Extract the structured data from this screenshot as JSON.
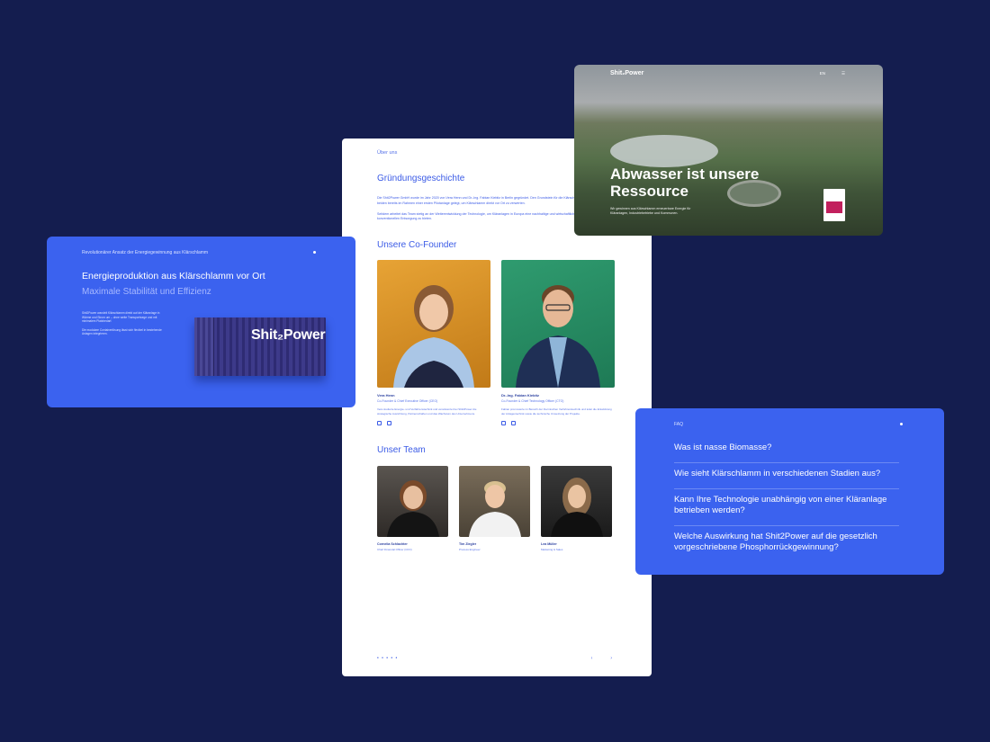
{
  "page": {
    "breadcrumb": "Über uns",
    "story_heading": "Gründungsgeschichte",
    "story_p1": "Die Shit2Power GmbH wurde im Jahr 2020 von Vera Henn und Dr.-Ing. Fabian Kiebitz in Berlin gegründet. Den Grundstein für die Klärschlammverwertung hatten die beiden bereits im Rahmen einer ersten Pilotanlage gelegt, um Klärschlamm direkt vor Ort zu verwerten.",
    "story_p2": "Seitdem arbeitet das Team stetig an der Weiterentwicklung der Technologie, um Kläranlagen in Europa eine nachhaltige und wirtschaftliche Alternative zur konventionellen Entsorgung zu bieten.",
    "cofounders_heading": "Unsere Co-Founder",
    "founders": [
      {
        "name": "Vera Henn",
        "role": "Co-Founder & Chief Executive Officer (CEO)",
        "bio": "Vera studierte Energie- und Verfahrenstechnik und verantwortet bei Shit2Power die strategische Ausrichtung, Partnerschaften und das Wachstum des Unternehmens."
      },
      {
        "name": "Dr.-Ing. Fabian Kiebitz",
        "role": "Co-Founder & Chief Technology Officer (CTO)",
        "bio": "Fabian promovierte im Bereich der thermischen Verfahrenstechnik und leitet die Entwicklung der Anlagentechnik sowie die technische Umsetzung der Projekte."
      }
    ],
    "team_heading": "Unser Team",
    "team": [
      {
        "name": "Cornelia Schlachter",
        "role": "Chief Financial Officer (CFO)"
      },
      {
        "name": "Tim Ziegler",
        "role": "Process Engineer"
      },
      {
        "name": "Lea Müller",
        "role": "Marketing & Sales"
      }
    ],
    "pager": "• • • • •",
    "prev": "‹",
    "next": "›"
  },
  "energy": {
    "kicker": "Revolutionärer Ansatz der Energiegewinnung aus Klärschlamm",
    "title": "Energieproduktion aus Klärschlamm vor Ort",
    "subtitle": "Maximale Stabilität und Effizienz",
    "body1": "Shit2Power wandelt Klärschlamm direkt auf der Kläranlage in Wärme und Strom um – ohne weite Transportwege und mit minimalem Platzbedarf.",
    "body2": "Die modulare Containerlösung lässt sich flexibel in bestehende Anlagen integrieren.",
    "container_brand": "Shit₂Power"
  },
  "hero": {
    "brand": "Shit₂Power",
    "nav_lang": "EN",
    "nav_menu": "☰",
    "headline": "Abwasser ist unsere Ressource",
    "lede": "Wir gewinnen aus Klärschlamm erneuerbare Energie für Kläranlagen, Industriebetriebe und Kommunen."
  },
  "faq": {
    "label": "FAQ",
    "questions": [
      "Was ist nasse Biomasse?",
      "Wie sieht Klärschlamm in verschiedenen Stadien aus?",
      "Kann Ihre Technologie unabhängig von einer Kläranlage betrieben werden?",
      "Welche Auswirkung hat Shit2Power auf die gesetzlich vorgeschriebene Phosphorrückgewinnung?"
    ]
  }
}
